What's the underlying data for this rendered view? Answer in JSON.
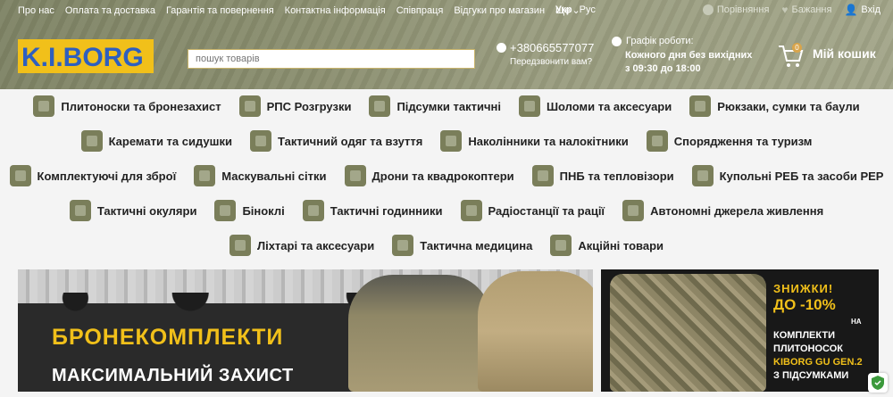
{
  "nav": {
    "items": [
      "Про нас",
      "Оплата та доставка",
      "Гарантія та повернення",
      "Контактна інформація",
      "Співпраця",
      "Відгуки про магазин",
      "Ще"
    ],
    "lang": [
      "Укр",
      "Рус"
    ]
  },
  "tools": {
    "compare": "Порівняння",
    "wishlist": "Бажання",
    "login": "Вхід"
  },
  "logo_text": "K.I.BORG",
  "search": {
    "placeholder": "пошук товарів"
  },
  "contact": {
    "phone": "+380665577077",
    "callback": "Передзвонити вам?"
  },
  "schedule": {
    "title": "Графік роботи:",
    "line1": "Кожного дня без вихідних",
    "line2": "з 09:30 до 18:00"
  },
  "cart": {
    "count": "0",
    "label": "Мій кошик"
  },
  "categories": {
    "row1": [
      {
        "label": "Плитоноски та бронезахист",
        "icon": "vest-icon"
      },
      {
        "label": "РПС Розгрузки",
        "icon": "harness-icon"
      },
      {
        "label": "Підсумки тактичні",
        "icon": "pouch-icon"
      },
      {
        "label": "Шоломи та аксесуари",
        "icon": "helmet-icon"
      },
      {
        "label": "Рюкзаки, сумки та баули",
        "icon": "backpack-icon"
      }
    ],
    "row2": [
      {
        "label": "Каремати та сидушки",
        "icon": "mat-icon"
      },
      {
        "label": "Тактичний одяг та взуття",
        "icon": "shirt-icon"
      },
      {
        "label": "Наколінники та налокітники",
        "icon": "kneepad-icon"
      },
      {
        "label": "Спорядження та туризм",
        "icon": "tent-icon"
      }
    ],
    "row3": [
      {
        "label": "Комплектуючі для зброї",
        "icon": "weapon-parts-icon"
      },
      {
        "label": "Маскувальні сітки",
        "icon": "net-icon"
      },
      {
        "label": "Дрони та квадрокоптери",
        "icon": "drone-icon"
      },
      {
        "label": "ПНБ та тепловізори",
        "icon": "nightvision-icon"
      },
      {
        "label": "Купольні РЕБ та засоби РЕР",
        "icon": "antenna-icon"
      }
    ],
    "row4": [
      {
        "label": "Тактичні окуляри",
        "icon": "glasses-icon"
      },
      {
        "label": "Біноклі",
        "icon": "binoculars-icon"
      },
      {
        "label": "Тактичні годинники",
        "icon": "watch-icon"
      },
      {
        "label": "Радіостанції та рації",
        "icon": "radio-icon"
      },
      {
        "label": "Автономні джерела живлення",
        "icon": "battery-icon"
      }
    ],
    "row5": [
      {
        "label": "Ліхтарі та аксесуари",
        "icon": "flashlight-icon"
      },
      {
        "label": "Тактична медицина",
        "icon": "medkit-icon"
      },
      {
        "label": "Акційні товари",
        "icon": "sale-icon"
      }
    ]
  },
  "hero_left": {
    "title": "БРОНЕКОМПЛЕКТИ",
    "subtitle": "МАКСИМАЛЬНИЙ ЗАХИСТ"
  },
  "hero_right": {
    "sale_word": "ЗНИЖКИ!",
    "sale_pct": "ДО -10%",
    "sale_on": "НА",
    "line1": "КОМПЛЕКТИ",
    "line2": "ПЛИТОНОСОК",
    "line3": "KIBORG GU GEN.2",
    "line4": "З ПІДСУМКАМИ"
  },
  "colors": {
    "header_bg": "#8b8f70",
    "accent_yellow": "#f1c01a",
    "logo_blue": "#2e5fbf",
    "logo_yellow": "#f1c01a"
  }
}
